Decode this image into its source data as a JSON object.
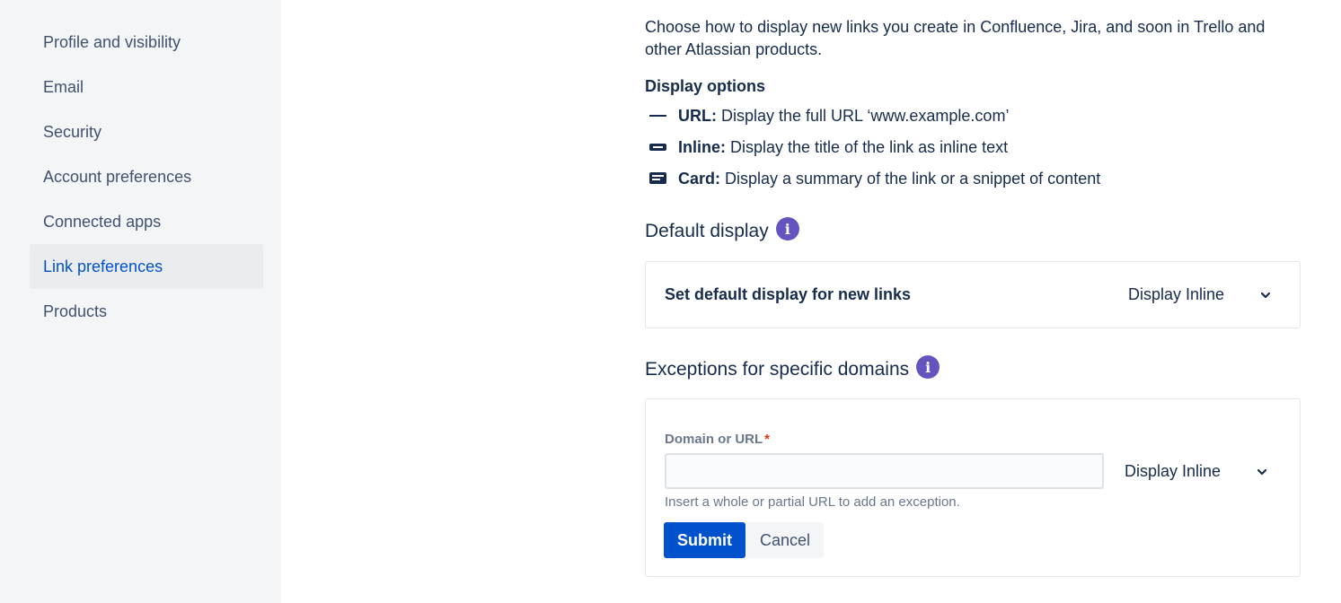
{
  "sidebar": {
    "items": [
      {
        "label": "Profile and visibility",
        "active": false
      },
      {
        "label": "Email",
        "active": false
      },
      {
        "label": "Security",
        "active": false
      },
      {
        "label": "Account preferences",
        "active": false
      },
      {
        "label": "Connected apps",
        "active": false
      },
      {
        "label": "Link preferences",
        "active": true
      },
      {
        "label": "Products",
        "active": false
      }
    ]
  },
  "main": {
    "intro": "Choose how to display new links you create in Confluence, Jira, and soon in Trello and other Atlassian products.",
    "display_options": {
      "title": "Display options",
      "options": [
        {
          "icon": "url-line-icon",
          "name": "URL:",
          "description": "Display the full URL ‘www.example.com’"
        },
        {
          "icon": "inline-link-icon",
          "name": "Inline:",
          "description": "Display the title of the link as inline text"
        },
        {
          "icon": "card-link-icon",
          "name": "Card:",
          "description": "Display a summary of the link or a snippet of content"
        }
      ]
    },
    "default_display": {
      "heading": "Default display",
      "info_icon": "info-icon",
      "setting_label": "Set default display for new links",
      "selected": "Display Inline"
    },
    "exceptions": {
      "heading": "Exceptions for specific domains",
      "info_icon": "info-icon",
      "field_label": "Domain or URL",
      "required_mark": "*",
      "input_value": "",
      "helper_text": "Insert a whole or partial URL to add an exception.",
      "selected": "Display Inline",
      "submit_label": "Submit",
      "cancel_label": "Cancel"
    }
  },
  "colors": {
    "sidebar_bg": "#f4f5f7",
    "active_item_bg": "#ebecf0",
    "active_item_text": "#0052cc",
    "primary": "#0052cc",
    "info_badge": "#6554c0",
    "required": "#de350b"
  }
}
